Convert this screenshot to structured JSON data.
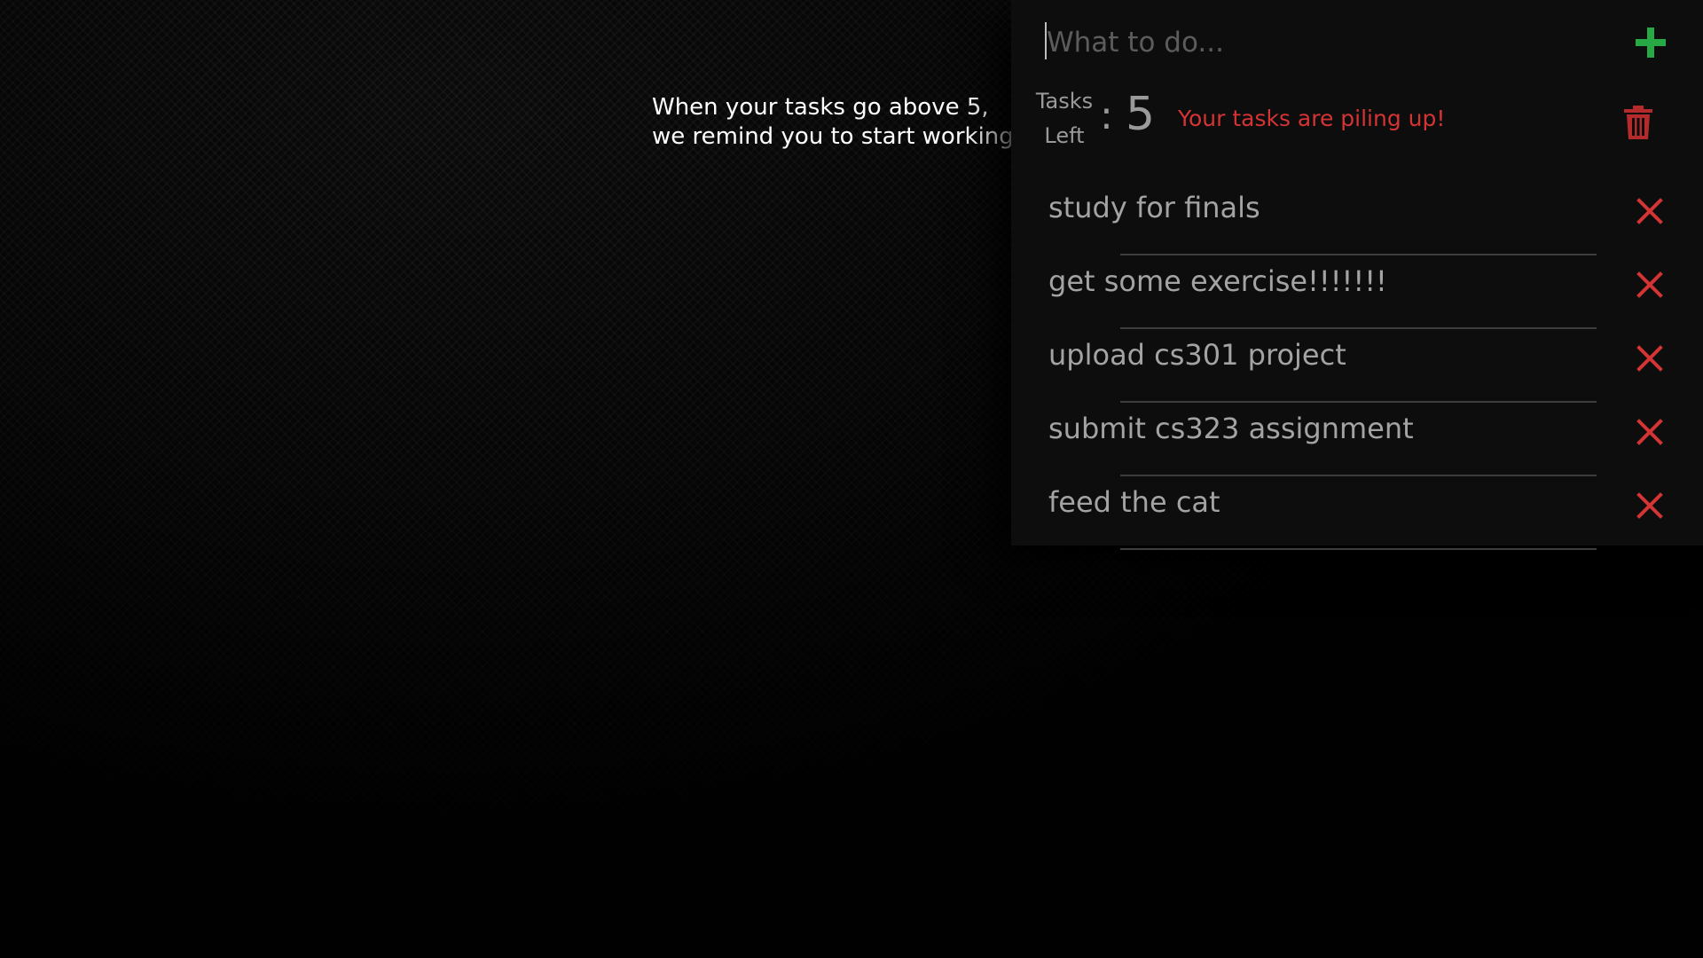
{
  "hint": {
    "line1": "When your tasks go above 5,",
    "line2": "we remind you to start working"
  },
  "input": {
    "placeholder": "What to do...",
    "value": ""
  },
  "add_button": {
    "icon": "plus-icon",
    "color": "#27a844"
  },
  "counter": {
    "label_line1": "Tasks",
    "label_line2": "Left",
    "separator": ":",
    "value": "5"
  },
  "warning": {
    "text": "Your tasks are piling up!",
    "color": "#d43434"
  },
  "clear_button": {
    "icon": "trash-icon",
    "color": "#b52a2a"
  },
  "tasks": [
    {
      "text": "study for finals"
    },
    {
      "text": "get some exercise!!!!!!!"
    },
    {
      "text": "upload cs301 project"
    },
    {
      "text": "submit cs323 assignment"
    },
    {
      "text": "feed the cat"
    }
  ],
  "delete_icon": {
    "icon": "close-icon",
    "color": "#d43434"
  }
}
